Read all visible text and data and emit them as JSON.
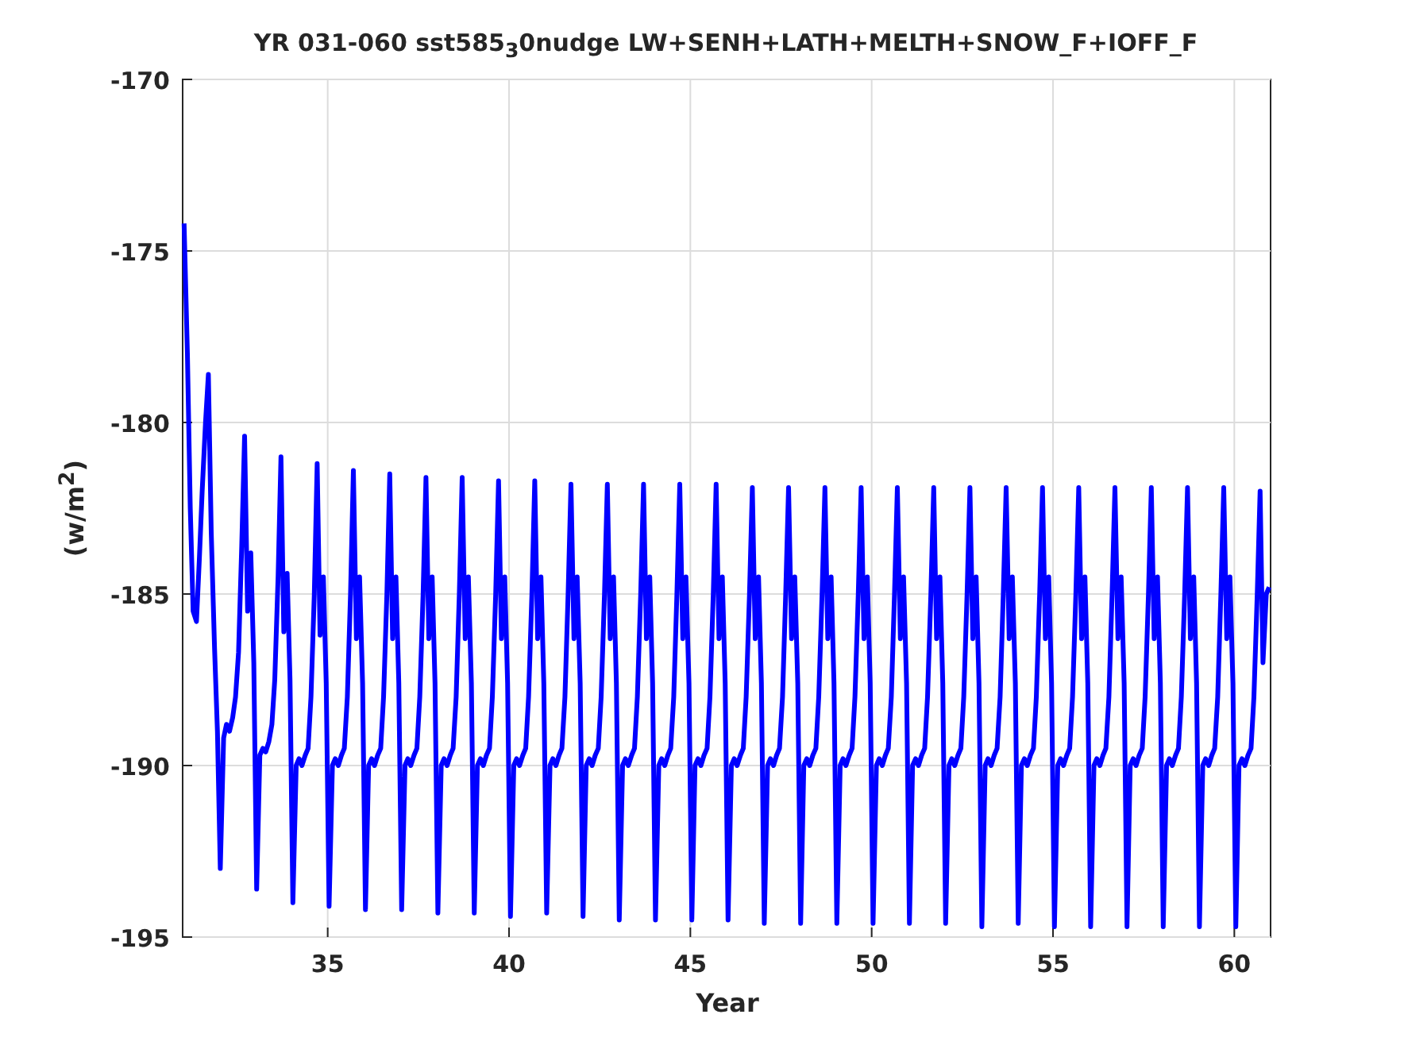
{
  "figure": {
    "chart_data": {
      "type": "line",
      "title": "YR 031-060 sst585$_{3}$0nudge LW+SENH+LATH+MELTH+SNOW_F+IOFF_F",
      "xlabel": "Year",
      "ylabel": "(w/m$^{2}$)",
      "xlim": [
        31,
        61
      ],
      "ylim": [
        -195,
        -170
      ],
      "xticks": [
        35,
        40,
        45,
        50,
        55,
        60
      ],
      "yticks": [
        -195,
        -190,
        -185,
        -180,
        -175,
        -170
      ],
      "grid": true,
      "x": [
        31.04,
        31.13,
        31.21,
        31.29,
        31.38,
        31.46,
        31.54,
        31.63,
        31.71,
        31.79,
        31.88,
        31.96,
        32.04,
        32.13,
        32.21,
        32.29,
        32.38,
        32.46,
        32.54,
        32.63,
        32.71,
        32.79,
        32.88,
        32.96,
        33.04,
        33.13,
        33.21,
        33.29,
        33.38,
        33.46,
        33.54,
        33.63,
        33.71,
        33.79,
        33.88,
        33.96,
        34.04,
        34.13,
        34.21,
        34.29,
        34.38,
        34.46,
        34.54,
        34.63,
        34.71,
        34.79,
        34.88,
        34.96,
        35.04,
        35.13,
        35.21,
        35.29,
        35.38,
        35.46,
        35.54,
        35.63,
        35.71,
        35.79,
        35.88,
        35.96,
        36.04,
        36.13,
        36.21,
        36.29,
        36.38,
        36.46,
        36.54,
        36.63,
        36.71,
        36.79,
        36.88,
        36.96,
        37.04,
        37.13,
        37.21,
        37.29,
        37.38,
        37.46,
        37.54,
        37.63,
        37.71,
        37.79,
        37.88,
        37.96,
        38.04,
        38.13,
        38.21,
        38.29,
        38.38,
        38.46,
        38.54,
        38.63,
        38.71,
        38.79,
        38.88,
        38.96,
        39.04,
        39.13,
        39.21,
        39.29,
        39.38,
        39.46,
        39.54,
        39.63,
        39.71,
        39.79,
        39.88,
        39.96,
        40.04,
        40.13,
        40.21,
        40.29,
        40.38,
        40.46,
        40.54,
        40.63,
        40.71,
        40.79,
        40.88,
        40.96,
        41.04,
        41.13,
        41.21,
        41.29,
        41.38,
        41.46,
        41.54,
        41.63,
        41.71,
        41.79,
        41.88,
        41.96,
        42.04,
        42.13,
        42.21,
        42.29,
        42.38,
        42.46,
        42.54,
        42.63,
        42.71,
        42.79,
        42.88,
        42.96,
        43.04,
        43.13,
        43.21,
        43.29,
        43.38,
        43.46,
        43.54,
        43.63,
        43.71,
        43.79,
        43.88,
        43.96,
        44.04,
        44.13,
        44.21,
        44.29,
        44.38,
        44.46,
        44.54,
        44.63,
        44.71,
        44.79,
        44.88,
        44.96,
        45.04,
        45.13,
        45.21,
        45.29,
        45.38,
        45.46,
        45.54,
        45.63,
        45.71,
        45.79,
        45.88,
        45.96,
        46.04,
        46.13,
        46.21,
        46.29,
        46.38,
        46.46,
        46.54,
        46.63,
        46.71,
        46.79,
        46.88,
        46.96,
        47.04,
        47.13,
        47.21,
        47.29,
        47.38,
        47.46,
        47.54,
        47.63,
        47.71,
        47.79,
        47.88,
        47.96,
        48.04,
        48.13,
        48.21,
        48.29,
        48.38,
        48.46,
        48.54,
        48.63,
        48.71,
        48.79,
        48.88,
        48.96,
        49.04,
        49.13,
        49.21,
        49.29,
        49.38,
        49.46,
        49.54,
        49.63,
        49.71,
        49.79,
        49.88,
        49.96,
        50.04,
        50.13,
        50.21,
        50.29,
        50.38,
        50.46,
        50.54,
        50.63,
        50.71,
        50.79,
        50.88,
        50.96,
        51.04,
        51.13,
        51.21,
        51.29,
        51.38,
        51.46,
        51.54,
        51.63,
        51.71,
        51.79,
        51.88,
        51.96,
        52.04,
        52.13,
        52.21,
        52.29,
        52.38,
        52.46,
        52.54,
        52.63,
        52.71,
        52.79,
        52.88,
        52.96,
        53.04,
        53.13,
        53.21,
        53.29,
        53.38,
        53.46,
        53.54,
        53.63,
        53.71,
        53.79,
        53.88,
        53.96,
        54.04,
        54.13,
        54.21,
        54.29,
        54.38,
        54.46,
        54.54,
        54.63,
        54.71,
        54.79,
        54.88,
        54.96,
        55.04,
        55.13,
        55.21,
        55.29,
        55.38,
        55.46,
        55.54,
        55.63,
        55.71,
        55.79,
        55.88,
        55.96,
        56.04,
        56.13,
        56.21,
        56.29,
        56.38,
        56.46,
        56.54,
        56.63,
        56.71,
        56.79,
        56.88,
        56.96,
        57.04,
        57.13,
        57.21,
        57.29,
        57.38,
        57.46,
        57.54,
        57.63,
        57.71,
        57.79,
        57.88,
        57.96,
        58.04,
        58.13,
        58.21,
        58.29,
        58.38,
        58.46,
        58.54,
        58.63,
        58.71,
        58.79,
        58.88,
        58.96,
        59.04,
        59.13,
        59.21,
        59.29,
        59.38,
        59.46,
        59.54,
        59.63,
        59.71,
        59.79,
        59.88,
        59.96,
        60.04,
        60.13,
        60.21,
        60.29,
        60.38,
        60.46,
        60.54,
        60.63,
        60.71,
        60.79,
        60.88,
        60.96
      ],
      "series": [
        {
          "color": "#0000ff",
          "values": [
            -174.2,
            -178,
            -182.5,
            -185.5,
            -185.8,
            -184,
            -182,
            -180,
            -178.6,
            -183.2,
            -186.6,
            -189,
            -193,
            -189.2,
            -188.8,
            -189,
            -188.6,
            -188,
            -186.7,
            -183.6,
            -180.4,
            -185.5,
            -183.8,
            -187,
            -193.6,
            -189.7,
            -189.5,
            -189.6,
            -189.3,
            -188.8,
            -187.5,
            -184.5,
            -181,
            -186.1,
            -184.4,
            -187.5,
            -194,
            -190,
            -189.8,
            -190,
            -189.7,
            -189.5,
            -188,
            -185,
            -181.2,
            -186.2,
            -184.5,
            -187.6,
            -194.1,
            -190,
            -189.8,
            -190,
            -189.7,
            -189.5,
            -188,
            -185,
            -181.4,
            -186.3,
            -184.5,
            -187.6,
            -194.2,
            -190,
            -189.8,
            -190,
            -189.7,
            -189.5,
            -188,
            -185,
            -181.5,
            -186.3,
            -184.5,
            -187.6,
            -194.2,
            -190,
            -189.8,
            -190,
            -189.7,
            -189.5,
            -188,
            -185,
            -181.6,
            -186.3,
            -184.5,
            -187.6,
            -194.3,
            -190,
            -189.8,
            -190,
            -189.7,
            -189.5,
            -188,
            -185,
            -181.6,
            -186.3,
            -184.5,
            -187.6,
            -194.3,
            -190,
            -189.8,
            -190,
            -189.7,
            -189.5,
            -188,
            -185,
            -181.7,
            -186.3,
            -184.5,
            -187.6,
            -194.4,
            -190,
            -189.8,
            -190,
            -189.7,
            -189.5,
            -188,
            -185,
            -181.7,
            -186.3,
            -184.5,
            -187.6,
            -194.3,
            -190,
            -189.8,
            -190,
            -189.7,
            -189.5,
            -188,
            -185,
            -181.8,
            -186.3,
            -184.5,
            -187.6,
            -194.4,
            -190,
            -189.8,
            -190,
            -189.7,
            -189.5,
            -188,
            -185,
            -181.8,
            -186.3,
            -184.5,
            -187.6,
            -194.5,
            -190,
            -189.8,
            -190,
            -189.7,
            -189.5,
            -188,
            -185,
            -181.8,
            -186.3,
            -184.5,
            -187.6,
            -194.5,
            -190,
            -189.8,
            -190,
            -189.7,
            -189.5,
            -188,
            -185,
            -181.8,
            -186.3,
            -184.5,
            -187.6,
            -194.5,
            -190,
            -189.8,
            -190,
            -189.7,
            -189.5,
            -188,
            -185,
            -181.8,
            -186.3,
            -184.5,
            -187.6,
            -194.5,
            -190,
            -189.8,
            -190,
            -189.7,
            -189.5,
            -188,
            -185,
            -181.9,
            -186.3,
            -184.5,
            -187.6,
            -194.6,
            -190,
            -189.8,
            -190,
            -189.7,
            -189.5,
            -188,
            -185,
            -181.9,
            -186.3,
            -184.5,
            -187.6,
            -194.6,
            -190,
            -189.8,
            -190,
            -189.7,
            -189.5,
            -188,
            -185,
            -181.9,
            -186.3,
            -184.5,
            -187.6,
            -194.6,
            -190,
            -189.8,
            -190,
            -189.7,
            -189.5,
            -188,
            -185,
            -181.9,
            -186.3,
            -184.5,
            -187.6,
            -194.6,
            -190,
            -189.8,
            -190,
            -189.7,
            -189.5,
            -188,
            -185,
            -181.9,
            -186.3,
            -184.5,
            -187.6,
            -194.6,
            -190,
            -189.8,
            -190,
            -189.7,
            -189.5,
            -188,
            -185,
            -181.9,
            -186.3,
            -184.5,
            -187.6,
            -194.6,
            -190,
            -189.8,
            -190,
            -189.7,
            -189.5,
            -188,
            -185,
            -181.9,
            -186.3,
            -184.5,
            -187.6,
            -194.7,
            -190,
            -189.8,
            -190,
            -189.7,
            -189.5,
            -188,
            -185,
            -181.9,
            -186.3,
            -184.5,
            -187.6,
            -194.6,
            -190,
            -189.8,
            -190,
            -189.7,
            -189.5,
            -188,
            -185,
            -181.9,
            -186.3,
            -184.5,
            -187.6,
            -194.7,
            -190,
            -189.8,
            -190,
            -189.7,
            -189.5,
            -188,
            -185,
            -181.9,
            -186.3,
            -184.5,
            -187.6,
            -194.7,
            -190,
            -189.8,
            -190,
            -189.7,
            -189.5,
            -188,
            -185,
            -181.9,
            -186.3,
            -184.5,
            -187.6,
            -194.7,
            -190,
            -189.8,
            -190,
            -189.7,
            -189.5,
            -188,
            -185,
            -181.9,
            -186.3,
            -184.5,
            -187.6,
            -194.7,
            -190,
            -189.8,
            -190,
            -189.7,
            -189.5,
            -188,
            -185,
            -181.9,
            -186.3,
            -184.5,
            -187.6,
            -194.7,
            -190,
            -189.8,
            -190,
            -189.7,
            -189.5,
            -188,
            -185,
            -181.9,
            -186.3,
            -184.5,
            -187.6,
            -194.7,
            -190,
            -189.8,
            -190,
            -189.7,
            -189.5,
            -188,
            -185,
            -182,
            -187,
            -185,
            -184.8
          ]
        }
      ]
    }
  }
}
